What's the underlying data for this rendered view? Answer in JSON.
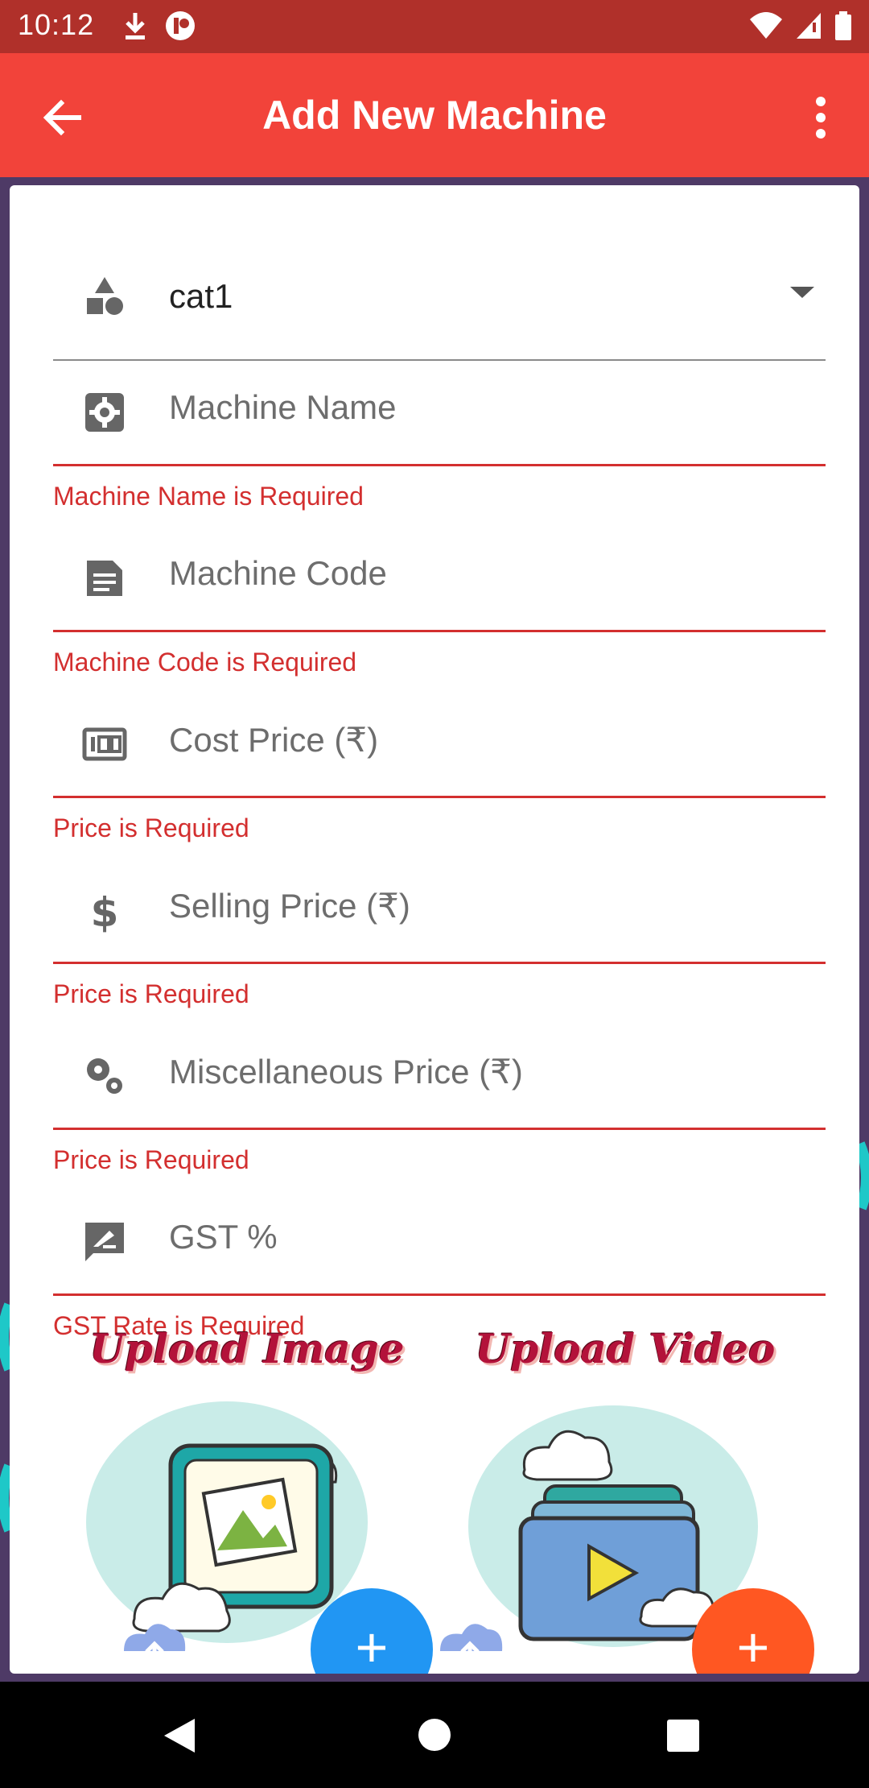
{
  "status_bar": {
    "time": "10:12"
  },
  "app_bar": {
    "title": "Add New Machine"
  },
  "form": {
    "category": {
      "value": "cat1"
    },
    "machine_name": {
      "placeholder": "Machine Name",
      "error": "Machine Name is Required"
    },
    "machine_code": {
      "placeholder": "Machine Code",
      "error": "Machine Code is Required"
    },
    "cost_price": {
      "placeholder": "Cost Price (₹)",
      "error": "Price is Required"
    },
    "selling_price": {
      "placeholder": "Selling Price (₹)",
      "error": "Price is Required"
    },
    "misc_price": {
      "placeholder": "Miscellaneous Price (₹)",
      "error": "Price is Required"
    },
    "gst": {
      "placeholder": "GST %",
      "error": "GST Rate is Required"
    }
  },
  "uploads": {
    "image": {
      "title": "Upload Image",
      "button_color": "#2196f3"
    },
    "video": {
      "title": "Upload Video",
      "button_color": "#ff5722"
    }
  },
  "colors": {
    "primary": "#f2433a",
    "status_bar": "#b0302a",
    "error": "#d32f2f"
  }
}
